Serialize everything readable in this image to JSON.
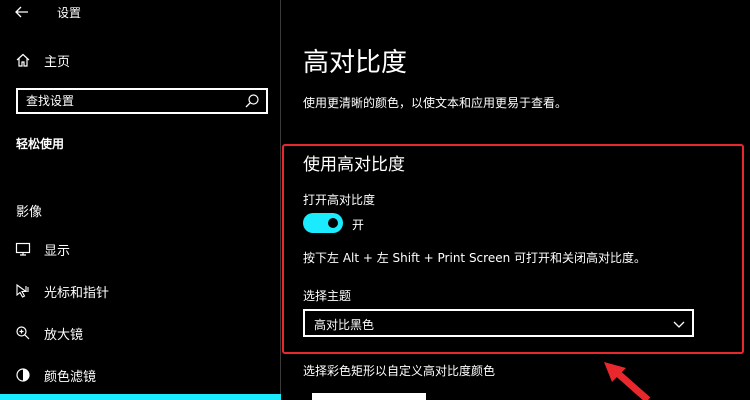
{
  "window": {
    "title": "设置"
  },
  "sidebar": {
    "home_label": "主页",
    "search": {
      "placeholder": "查找设置",
      "value": ""
    },
    "category_heading": "轻松使用",
    "group_heading": "影像",
    "items": [
      {
        "label": "显示",
        "icon": "monitor-icon"
      },
      {
        "label": "光标和指针",
        "icon": "pointer-icon"
      },
      {
        "label": "放大镜",
        "icon": "magnifier-icon"
      },
      {
        "label": "颜色滤镜",
        "icon": "color-filter-icon"
      }
    ]
  },
  "main": {
    "title": "高对比度",
    "description": "使用更清晰的颜色，以使文本和应用更易于查看。",
    "section_title": "使用高对比度",
    "toggle": {
      "label": "打开高对比度",
      "state_text": "开",
      "on": true
    },
    "shortcut_text": "按下左 Alt + 左 Shift + Print Screen 可打开和关闭高对比度。",
    "theme": {
      "label": "选择主题",
      "selected": "高对比黑色"
    },
    "custom_label": "选择彩色矩形以自定义高对比度颜色"
  },
  "colors": {
    "accent": "#1aebff",
    "highlight_border": "#e8282c",
    "background": "#000000",
    "text": "#ffffff"
  }
}
